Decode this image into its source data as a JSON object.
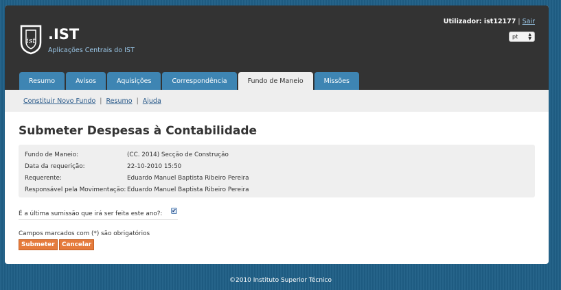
{
  "header": {
    "brand_title": ".IST",
    "brand_subtitle": "Aplicações Centrais do IST",
    "user_label": "Utilizador: ist12177",
    "separator": "|",
    "logout_label": "Sair",
    "language": "pt"
  },
  "tabs": [
    {
      "label": "Resumo"
    },
    {
      "label": "Avisos"
    },
    {
      "label": "Aquisições"
    },
    {
      "label": "Correspondência"
    },
    {
      "label": "Fundo de Maneio",
      "active": true
    },
    {
      "label": "Missões"
    }
  ],
  "subnav": {
    "items": [
      "Constituir Novo Fundo",
      "Resumo",
      "Ajuda"
    ],
    "separator": "|"
  },
  "main": {
    "title": "Submeter Despesas à Contabilidade",
    "info": [
      {
        "label": "Fundo de Maneio:",
        "value": "(CC. 2014) Secção de Construção"
      },
      {
        "label": "Data da requerição:",
        "value": "22-10-2010 15:50"
      },
      {
        "label": "Requerente:",
        "value": "Eduardo Manuel Baptista Ribeiro Pereira"
      },
      {
        "label": "Responsável pela Movimentação:",
        "value": "Eduardo Manuel Baptista Ribeiro Pereira"
      }
    ],
    "question": "É a última sumissão que irá ser feita este ano?:",
    "question_checked": true,
    "checkmark": "✔",
    "required_note": "Campos marcados com (*) são obrigatórios",
    "submit_label": "Submeter",
    "cancel_label": "Cancelar"
  },
  "footer": {
    "text": "©2010 Instituto Superior Técnico"
  },
  "colors": {
    "background": "#1f5f86",
    "header": "#333333",
    "tab": "#3e85b3",
    "button": "#e57b3c"
  }
}
